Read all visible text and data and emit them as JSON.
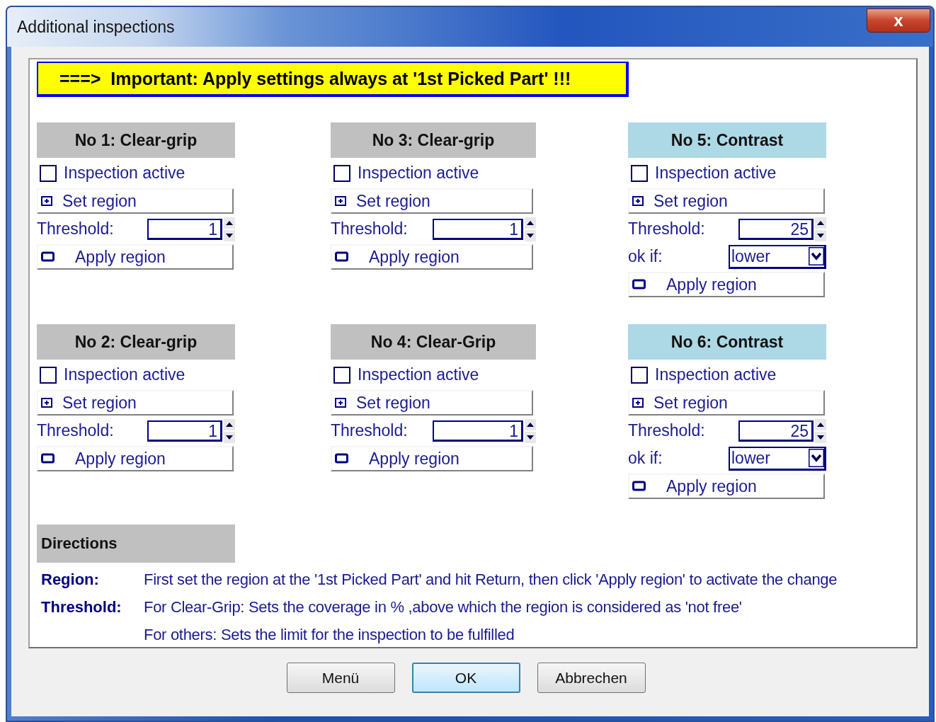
{
  "window": {
    "title": "Additional inspections",
    "close_label": "x"
  },
  "banner": {
    "text": "===>  Important: Apply settings always at '1st Picked Part' !!!"
  },
  "panels": [
    {
      "kind": "clear-grip",
      "title": "No 1: Clear-grip",
      "checkbox": {
        "label": "Inspection active",
        "checked": false
      },
      "set_region": "Set region",
      "threshold_label": "Threshold:",
      "threshold_value": "1",
      "apply": "Apply region"
    },
    {
      "kind": "clear-grip",
      "title": "No 3: Clear-grip",
      "checkbox": {
        "label": "Inspection active",
        "checked": false
      },
      "set_region": "Set region",
      "threshold_label": "Threshold:",
      "threshold_value": "1",
      "apply": "Apply region"
    },
    {
      "kind": "contrast",
      "title": "No 5: Contrast",
      "checkbox": {
        "label": "Inspection active",
        "checked": false
      },
      "set_region": "Set region",
      "threshold_label": "Threshold:",
      "threshold_value": "25",
      "ok_if_label": "ok if:",
      "ok_if_value": "lower",
      "apply": "Apply region"
    },
    {
      "kind": "clear-grip",
      "title": "No 2: Clear-grip",
      "checkbox": {
        "label": "Inspection active",
        "checked": false
      },
      "set_region": "Set region",
      "threshold_label": "Threshold:",
      "threshold_value": "1",
      "apply": "Apply region"
    },
    {
      "kind": "clear-grip",
      "title": "No 4: Clear-Grip",
      "checkbox": {
        "label": "Inspection active",
        "checked": false
      },
      "set_region": "Set region",
      "threshold_label": "Threshold:",
      "threshold_value": "1",
      "apply": "Apply region"
    },
    {
      "kind": "contrast",
      "title": "No 6: Contrast",
      "checkbox": {
        "label": "Inspection active",
        "checked": false
      },
      "set_region": "Set region",
      "threshold_label": "Threshold:",
      "threshold_value": "25",
      "ok_if_label": "ok if:",
      "ok_if_value": "lower",
      "apply": "Apply region"
    }
  ],
  "directions": {
    "title": "Directions",
    "rows": [
      {
        "term": "Region:",
        "text": "First set the region at the '1st Picked Part' and hit Return, then click 'Apply region' to activate the change"
      },
      {
        "term": "Threshold:",
        "text": "For Clear-Grip: Sets the coverage in % ,above which the region is considered as 'not free'"
      },
      {
        "term": "",
        "text": "For others: Sets the limit for the inspection to be fulfilled"
      }
    ]
  },
  "buttons": [
    {
      "label": "Menü",
      "selected": false
    },
    {
      "label": "OK",
      "selected": true
    },
    {
      "label": "Abbrechen",
      "selected": false
    }
  ]
}
